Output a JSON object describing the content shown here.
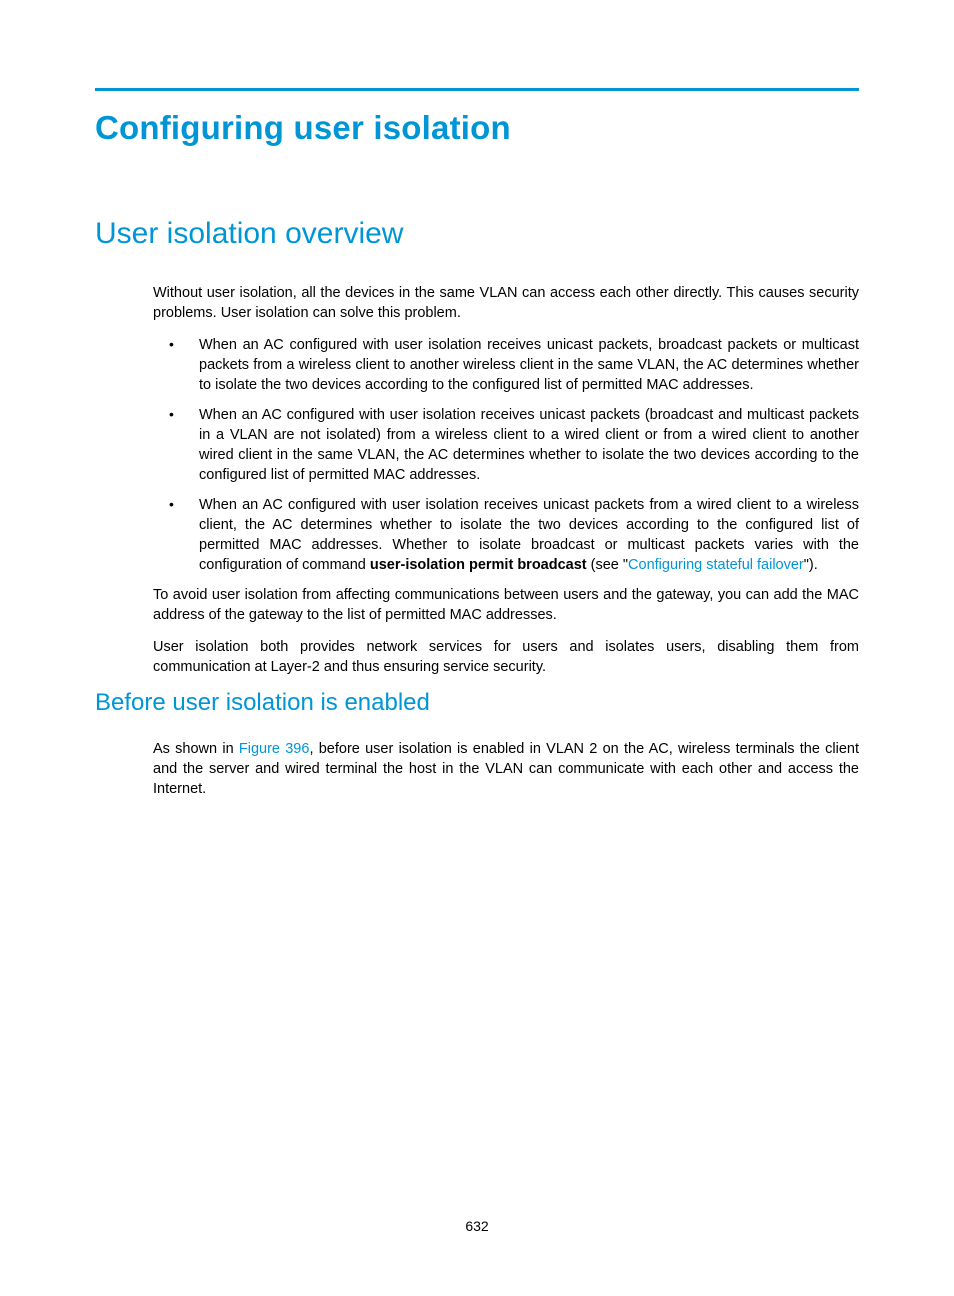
{
  "title": "Configuring user isolation",
  "section1": {
    "heading": "User isolation overview",
    "intro": "Without user isolation, all the devices in the same VLAN can access each other directly. This causes security problems. User isolation can solve this problem.",
    "bullets": [
      "When an AC configured with user isolation receives unicast packets, broadcast packets or multicast packets from a wireless client to another wireless client in the same VLAN, the AC determines whether to isolate the two devices according to the configured list of permitted MAC addresses.",
      "When an AC configured with user isolation receives unicast packets (broadcast and multicast packets in a VLAN are not isolated) from a wireless client to a wired client or from a wired client to another wired client in the same VLAN, the AC determines whether to isolate the two devices according to the configured list of permitted MAC addresses."
    ],
    "bullet3_pre": "When an AC configured with user isolation receives unicast packets from a wired client to a wireless client, the AC determines whether to isolate the two devices according to the configured list of permitted MAC addresses. Whether to isolate broadcast or multicast packets varies with the configuration of command ",
    "bullet3_cmd": "user-isolation permit broadcast",
    "bullet3_seeopen": " (see \"",
    "bullet3_link": "Configuring stateful failover",
    "bullet3_close": "\").",
    "para2": "To avoid user isolation from affecting communications between users and the gateway, you can add the MAC address of the gateway to the list of permitted MAC addresses.",
    "para3": "User isolation both provides network services for users and isolates users, disabling them from communication at Layer-2 and thus ensuring service security."
  },
  "section2": {
    "heading": "Before user isolation is enabled",
    "para_pre": "As shown in ",
    "para_link": "Figure 396",
    "para_post": ", before user isolation is enabled in VLAN 2 on the AC, wireless terminals the client and the server and wired terminal the host in the VLAN can communicate with each other and access the Internet."
  },
  "page_number": "632"
}
